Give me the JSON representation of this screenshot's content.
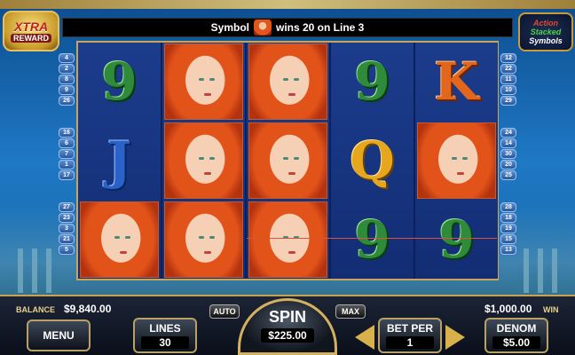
{
  "banner": {
    "message_prefix": "Symbol",
    "message_suffix": "wins 20 on Line 3",
    "logo_left_line1": "XTRA",
    "logo_left_line2": "REWARD",
    "logo_right_line1": "Action",
    "logo_right_line2": "Stacked",
    "logo_right_line3": "Symbols"
  },
  "reels": [
    [
      "9",
      "J",
      "maiden"
    ],
    [
      "maiden",
      "maiden",
      "maiden"
    ],
    [
      "maiden",
      "maiden",
      "maiden"
    ],
    [
      "9",
      "Q",
      "9"
    ],
    [
      "K",
      "maiden",
      "9"
    ]
  ],
  "lines_left": [
    [
      "4",
      "2",
      "8",
      "9",
      "26"
    ],
    [
      "16",
      "6",
      "7",
      "1",
      "17"
    ],
    [
      "27",
      "23",
      "3",
      "21",
      "5"
    ]
  ],
  "lines_right": [
    [
      "12",
      "22",
      "11",
      "10",
      "29"
    ],
    [
      "24",
      "14",
      "30",
      "20",
      "25"
    ],
    [
      "28",
      "18",
      "19",
      "15",
      "13"
    ]
  ],
  "panel": {
    "balance_label": "BALANCE",
    "balance_value": "$9,840.00",
    "win_value": "$1,000.00",
    "win_label": "WIN",
    "menu_label": "MENU",
    "lines_label": "LINES",
    "lines_value": "30",
    "auto_label": "AUTO",
    "max_label": "MAX",
    "spin_label": "SPIN",
    "spin_value": "$225.00",
    "bet_label": "BET PER",
    "bet_value": "1",
    "denom_label": "DENOM",
    "denom_value": "$5.00"
  }
}
